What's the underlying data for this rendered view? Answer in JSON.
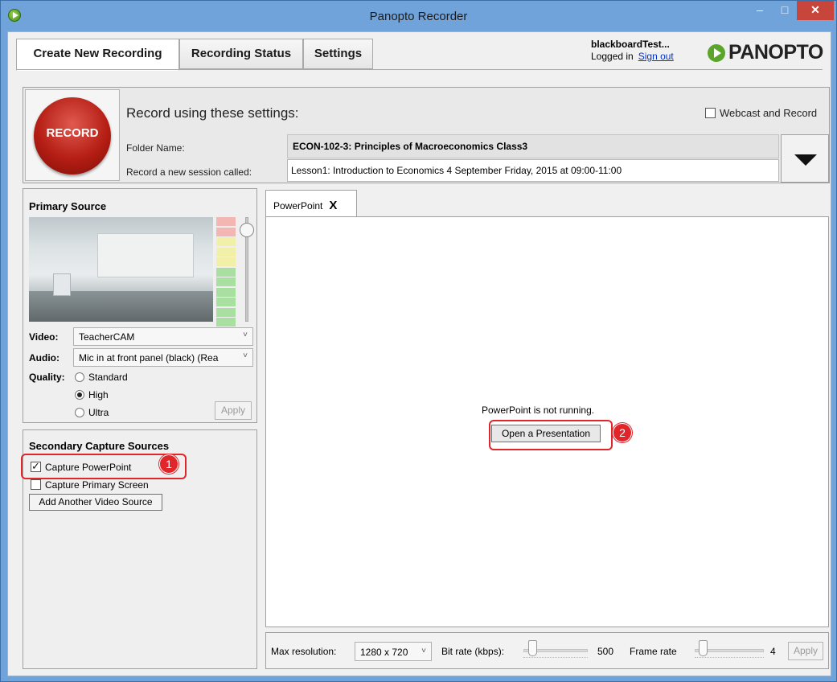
{
  "window": {
    "title": "Panopto Recorder",
    "controls": {
      "minimize": "–",
      "maximize": "□",
      "close": "✕"
    }
  },
  "tabs": [
    {
      "label": "Create New Recording",
      "active": true
    },
    {
      "label": "Recording Status",
      "active": false
    },
    {
      "label": "Settings",
      "active": false
    }
  ],
  "user": {
    "name": "blackboardTest...",
    "status": "Logged in",
    "sign_out": "Sign out"
  },
  "logo": {
    "text": "PANOPTO",
    "icon": "panopto-play-icon"
  },
  "record": {
    "button_label": "RECORD",
    "heading": "Record using these settings:",
    "webcast_label": "Webcast and Record",
    "webcast_checked": false,
    "folder_label": "Folder Name:",
    "folder_value": "ECON-102-3: Principles of Macroeconomics Class3",
    "session_label": "Record a new session called:",
    "session_value": "Lesson1: Introduction to Economics 4 September Friday,  2015 at 09:00-11:00"
  },
  "primary_source": {
    "title": "Primary Source",
    "video_label": "Video:",
    "video_value": "TeacherCAM",
    "audio_label": "Audio:",
    "audio_value": "Mic in at front panel (black) (Rea",
    "quality_label": "Quality:",
    "quality_options": [
      {
        "label": "Standard",
        "selected": false
      },
      {
        "label": "High",
        "selected": true
      },
      {
        "label": "Ultra",
        "selected": false
      }
    ],
    "apply_label": "Apply",
    "meter_colors": [
      "#f4b6b2",
      "#f4b6b2",
      "#f2f0a8",
      "#f2f0a8",
      "#f2f0a8",
      "#a9e0a2",
      "#a9e0a2",
      "#a9e0a2",
      "#a9e0a2",
      "#a9e0a2",
      "#a9e0a2"
    ]
  },
  "secondary_sources": {
    "title": "Secondary Capture Sources",
    "capture_powerpoint_label": "Capture PowerPoint",
    "capture_powerpoint_checked": true,
    "capture_screen_label": "Capture Primary Screen",
    "capture_screen_checked": false,
    "add_button_label": "Add Another Video Source"
  },
  "powerpoint": {
    "tab_label": "PowerPoint",
    "tab_close": "X",
    "message": "PowerPoint is not running.",
    "open_button": "Open a Presentation"
  },
  "callouts": [
    {
      "number": "1"
    },
    {
      "number": "2"
    }
  ],
  "bottom_bar": {
    "max_resolution_label": "Max resolution:",
    "max_resolution_value": "1280 x 720",
    "bitrate_label": "Bit rate (kbps):",
    "bitrate_value": "500",
    "framerate_label": "Frame rate",
    "framerate_value": "4",
    "apply_label": "Apply"
  },
  "colors": {
    "titlebar": "#6fa3da",
    "record_red": "#b51e14",
    "callout_red": "#e0262a",
    "panopto_green": "#5ba52a"
  }
}
